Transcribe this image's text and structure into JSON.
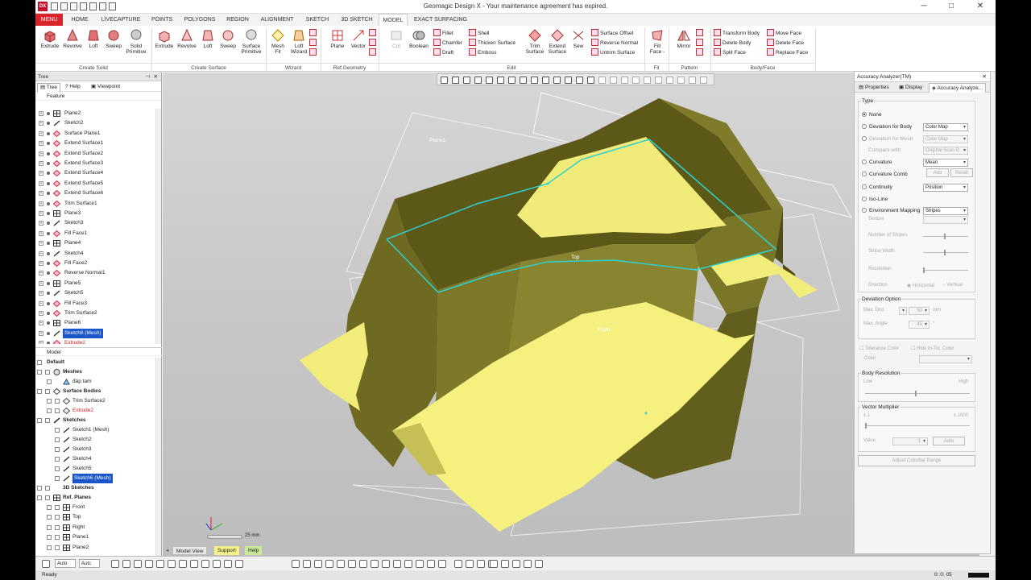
{
  "window": {
    "title": "Geomagic Design X - Your maintenance agreement has expired.",
    "logo": "DX"
  },
  "tabs": [
    "MENU",
    "HOME",
    "LIVECAPTURE",
    "POINTS",
    "POLYGONS",
    "REGION",
    "ALIGNMENT",
    "SKETCH",
    "3D SKETCH",
    "MODEL",
    "EXACT SURFACING"
  ],
  "active_tab": "MODEL",
  "ribbon": {
    "create_solid": {
      "label": "Create Solid",
      "buttons": [
        "Extrude",
        "Revolve",
        "Loft",
        "Sweep",
        "Solid\nPrimitive"
      ]
    },
    "create_surface": {
      "label": "Create Surface",
      "buttons": [
        "Extrude",
        "Revolve",
        "Loft",
        "Sweep",
        "Surface\nPrimitive"
      ]
    },
    "wizard": {
      "label": "Wizard",
      "buttons": [
        "Mesh\nFit",
        "Loft\nWizard"
      ]
    },
    "ref_geometry": {
      "label": "Ref.Geometry",
      "buttons": [
        "Plane",
        "Vector"
      ]
    },
    "edit": {
      "label": "Edit",
      "buttons": [
        "Cut",
        "Boolean"
      ],
      "small": [
        "Fillet",
        "Chamfer",
        "Draft",
        "Shell",
        "Thicken Surface",
        "Emboss"
      ],
      "buttons2": [
        "Trim\nSurface",
        "Extend\nSurface",
        "Sew"
      ],
      "small2": [
        "Surface Offset",
        "Reverse Normal",
        "Untrim Surface"
      ]
    },
    "fit": {
      "label": "Fit",
      "buttons": [
        "Fill\nFace -"
      ]
    },
    "pattern": {
      "label": "Pattern",
      "buttons": [
        "Mirror"
      ]
    },
    "body_face": {
      "label": "Body/Face",
      "small": [
        "Transform Body",
        "Delete Body",
        "Split Face",
        "Move Face",
        "Delete Face",
        "Replace Face"
      ]
    }
  },
  "tree_panel": {
    "title": "Tree",
    "tabs": [
      "Tree",
      "Help",
      "Viewpoint"
    ],
    "feature_header": "Feature",
    "features": [
      "Plane2",
      "Sketch2",
      "Surface Plane1",
      "Extend Surface1",
      "Extend Surface2",
      "Extend Surface3",
      "Extend Surface4",
      "Extend Surface5",
      "Extend Surface6",
      "Trim Surface1",
      "Plane3",
      "Sketch3",
      "Fill Face1",
      "Plane4",
      "Sketch4",
      "Fill Face2",
      "Reverse Normal1",
      "Plane5",
      "Sketch5",
      "Fill Face3",
      "Trim Surface2",
      "Plane6",
      "Sketch6 (Mesh)",
      "Extrude2"
    ],
    "selected_feature": "Sketch6 (Mesh)",
    "model_header": "Model",
    "model": {
      "default": "Default",
      "meshes": "Meshes",
      "mesh_item": "đáp tam",
      "surface_bodies": "Surface Bodies",
      "surface_items": [
        "Trim Surface2",
        "Extrude2"
      ],
      "sketches": "Sketches",
      "sketch_items": [
        "Sketch1 (Mesh)",
        "Sketch2",
        "Sketch3",
        "Sketch4",
        "Sketch5",
        "Sketch6 (Mesh)"
      ],
      "sketches3d": "3D Sketches",
      "ref_planes": "Ref. Planes",
      "plane_items": [
        "Front",
        "Top",
        "Right",
        "Plane1",
        "Plane2"
      ]
    }
  },
  "viewport": {
    "labels": [
      "Plane1",
      "Top",
      "Right"
    ],
    "scale": "25 mm",
    "colors": {
      "dark": "#6e6a22",
      "light": "#f2ec78",
      "edge": "#2fc8c8"
    }
  },
  "analyzer": {
    "title": "Accuracy Analyzer(TM)",
    "tabs": [
      "Properties",
      "Display",
      "Accuracy Analyze..."
    ],
    "type_label": "Type",
    "options": [
      {
        "label": "None",
        "checked": true,
        "dropdown": ""
      },
      {
        "label": "Deviation for Body",
        "dropdown": "Color Map"
      },
      {
        "label": "Deviation for Mesh",
        "dropdown": "Color Map",
        "disabled": true
      },
      {
        "label": "Compare with",
        "dropdown": "Original Scan D",
        "disabled": true
      },
      {
        "label": "Curvature",
        "dropdown": "Mean"
      },
      {
        "label": "Curvature Comb",
        "dropdown": ""
      },
      {
        "label": "Continuity",
        "dropdown": "Position"
      },
      {
        "label": "Iso-Line",
        "dropdown": ""
      },
      {
        "label": "Environment Mapping",
        "dropdown": "Stripes"
      }
    ],
    "add": "Add",
    "reset": "Reset",
    "texture": "Texture",
    "num_stripes": "Number of Stripes",
    "stripe_width": "Stripe Width",
    "resolution": "Resolution",
    "direction": "Direction",
    "horizontal": "Horizontal",
    "vertical": "Vertical",
    "deviation_option": "Deviation Option",
    "max_dist": "Max. Dist.",
    "max_dist_val": "50",
    "mm": "mm",
    "max_angle": "Max. Angle",
    "max_angle_val": "45",
    "deg": "°",
    "tolerance_color": "Tolerance Color",
    "hide_tol": "Hide In-Tol. Color",
    "color": "Color",
    "body_resolution": "Body Resolution",
    "low": "Low",
    "high": "High",
    "vector_multiplier": "Vector Multiplier",
    "x1": "x 1",
    "x1000": "x 1000",
    "value": "Value",
    "value_val": "1",
    "auto": "Auto",
    "adjust": "Adjust Colorbar Range"
  },
  "bottom": {
    "view_tabs": [
      "Model View",
      "Support",
      "Help"
    ],
    "auto1": "Auto",
    "auto2": "Autc",
    "status": "Ready",
    "coords": "0: 0: 05"
  }
}
